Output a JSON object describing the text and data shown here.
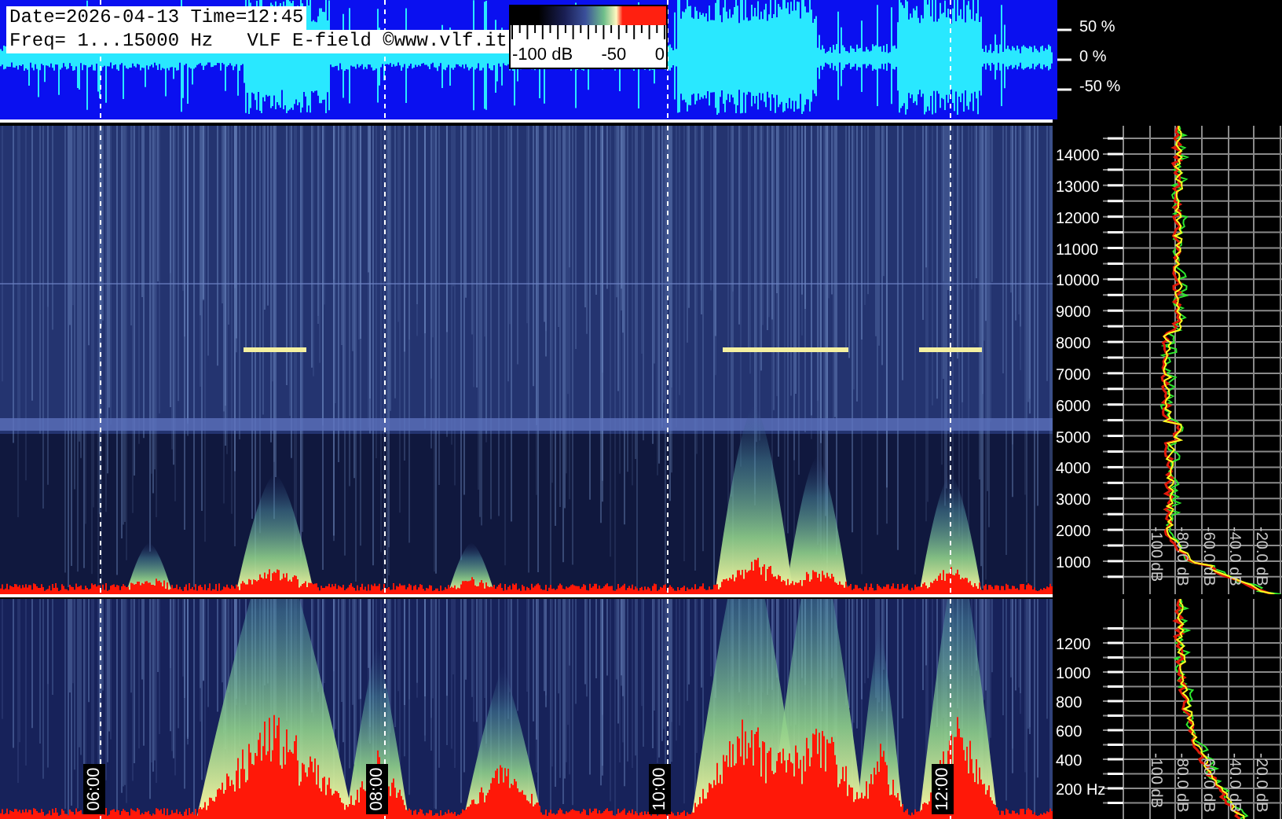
{
  "header": {
    "line_1": "Date=2026-04-13 Time=12:45",
    "line_2": "Freq= 1...15000 Hz   VLF E-field ©www.vlf.it"
  },
  "colorbar": {
    "labels": [
      "-100 dB",
      "-50",
      "0"
    ]
  },
  "waveform_axis": [
    "50 %",
    "0 %",
    "-50 %"
  ],
  "time_labels": [
    "06:00",
    "08:00",
    "10:00",
    "12:00"
  ],
  "upper_profile": {
    "frequency_labels": [
      "14000",
      "13000",
      "12000",
      "11000",
      "10000",
      "9000",
      "8000",
      "7000",
      "6000",
      "5000",
      "4000",
      "3000",
      "2000",
      "1000"
    ],
    "db_labels": [
      "-100 dB",
      "-80.0 dB",
      "-60.0 dB",
      "-40.0 dB",
      "-20.0 dB"
    ]
  },
  "lower_profile": {
    "frequency_labels": [
      "1200",
      "1000",
      "800",
      "600",
      "400",
      "200 Hz"
    ],
    "db_labels": [
      "-100 dB",
      "-80.0 dB",
      "-60.0 dB",
      "-40.0 dB",
      "-20.0 dB"
    ]
  }
}
